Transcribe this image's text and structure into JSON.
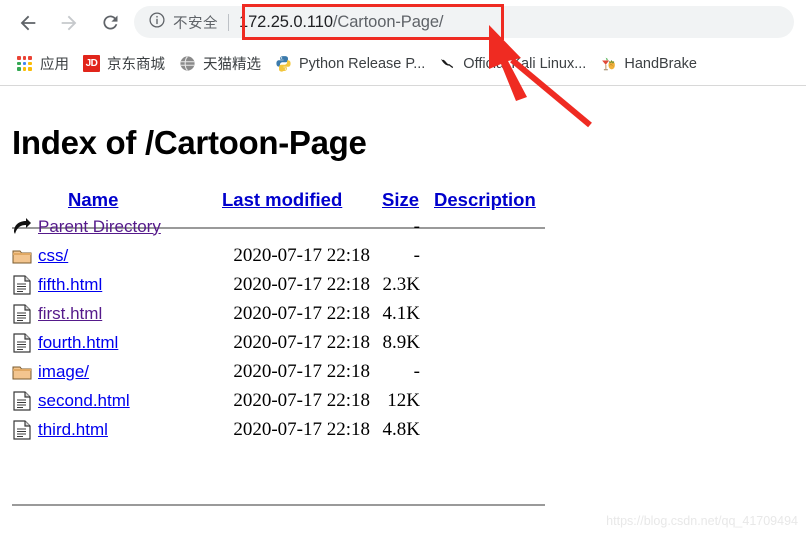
{
  "browser": {
    "nav": {
      "back_label": "Back",
      "forward_label": "Forward",
      "reload_label": "Reload"
    },
    "omnibox": {
      "security_text": "不安全",
      "security_icon": "info-circle-icon",
      "url_host": "172.25.0.110",
      "url_path": "/Cartoon-Page/",
      "url_full": "172.25.0.110/Cartoon-Page/"
    },
    "bookmarks": [
      {
        "label": "应用",
        "icon": "apps-grid-icon"
      },
      {
        "label": "京东商城",
        "icon": "jd-icon"
      },
      {
        "label": "天猫精选",
        "icon": "globe-icon"
      },
      {
        "label": "Python Release P...",
        "icon": "python-icon"
      },
      {
        "label": "Official Kali Linux...",
        "icon": "kali-dragon-icon"
      },
      {
        "label": "HandBrake",
        "icon": "handbrake-cocktail-icon"
      }
    ]
  },
  "page": {
    "title": "Index of /Cartoon-Page",
    "columns": [
      {
        "label": "Name"
      },
      {
        "label": "Last modified"
      },
      {
        "label": "Size"
      },
      {
        "label": "Description"
      }
    ],
    "rows": [
      {
        "icon": "parent-directory-icon",
        "name": "Parent Directory",
        "visited": true,
        "modified": "",
        "size": "-",
        "description": ""
      },
      {
        "icon": "folder-icon",
        "name": "css/",
        "visited": false,
        "modified": "2020-07-17 22:18",
        "size": "-",
        "description": ""
      },
      {
        "icon": "file-icon",
        "name": "fifth.html",
        "visited": false,
        "modified": "2020-07-17 22:18",
        "size": "2.3K",
        "description": ""
      },
      {
        "icon": "file-icon",
        "name": "first.html",
        "visited": true,
        "modified": "2020-07-17 22:18",
        "size": "4.1K",
        "description": ""
      },
      {
        "icon": "file-icon",
        "name": "fourth.html",
        "visited": false,
        "modified": "2020-07-17 22:18",
        "size": "8.9K",
        "description": ""
      },
      {
        "icon": "folder-icon",
        "name": "image/",
        "visited": false,
        "modified": "2020-07-17 22:18",
        "size": "-",
        "description": ""
      },
      {
        "icon": "file-icon",
        "name": "second.html",
        "visited": false,
        "modified": "2020-07-17 22:18",
        "size": "12K",
        "description": ""
      },
      {
        "icon": "file-icon",
        "name": "third.html",
        "visited": false,
        "modified": "2020-07-17 22:18",
        "size": "4.8K",
        "description": ""
      }
    ],
    "watermark": "https://blog.csdn.net/qq_41709494"
  },
  "annotation": {
    "highlight_color": "#ef2b22",
    "arrow_label": "red-pointer-arrow",
    "box_label": "url-highlight-box"
  }
}
